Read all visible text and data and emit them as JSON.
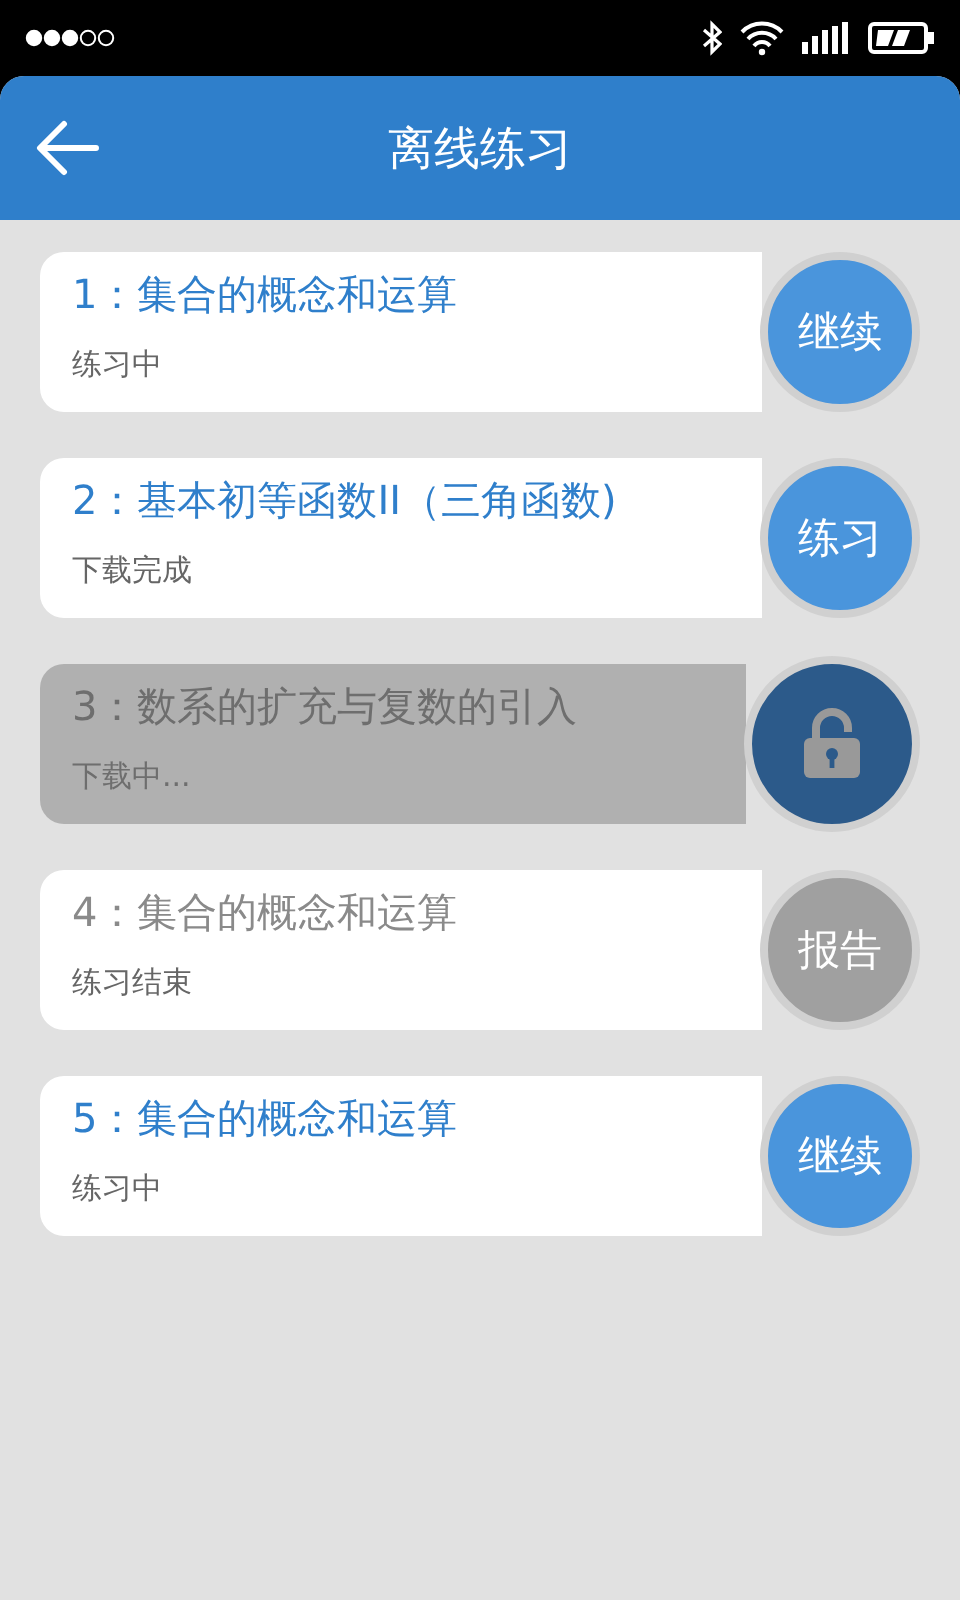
{
  "header": {
    "title": "离线练习"
  },
  "lessons": [
    {
      "title": "1：集合的概念和运算",
      "status": "练习中",
      "kind": "active",
      "action": "继续"
    },
    {
      "title": "2：基本初等函数II（三角函数)",
      "status": "下载完成",
      "kind": "active",
      "action": "练习"
    },
    {
      "title": "3：数系的扩充与复数的引入",
      "status": "下载中...",
      "kind": "locked"
    },
    {
      "title": "4：集合的概念和运算",
      "status": "练习结束",
      "kind": "finished",
      "action": "报告"
    },
    {
      "title": "5：集合的概念和运算",
      "status": "练习中",
      "kind": "active",
      "action": "继续"
    }
  ]
}
